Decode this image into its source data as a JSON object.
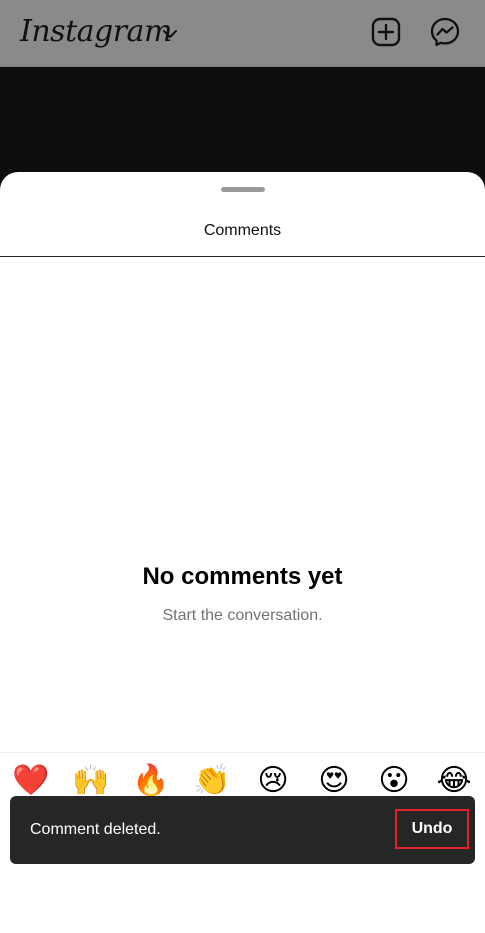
{
  "header": {
    "title": "Instagram",
    "icons": {
      "chevron": "chevron-down-icon",
      "add": "add-square-icon",
      "messenger": "messenger-icon"
    }
  },
  "sheet": {
    "title": "Comments",
    "empty_state": {
      "title": "No comments yet",
      "subtitle": "Start the conversation."
    }
  },
  "emoji_bar": {
    "emojis": [
      {
        "name": "red-heart",
        "char": "❤️"
      },
      {
        "name": "raising-hands",
        "char": "🙌"
      },
      {
        "name": "fire",
        "char": "🔥"
      },
      {
        "name": "clapping-hands",
        "char": "👏"
      },
      {
        "name": "crying-face",
        "char": "😢"
      },
      {
        "name": "heart-eyes",
        "char": "😍"
      },
      {
        "name": "astonished-face",
        "char": "😮"
      },
      {
        "name": "tears-of-joy",
        "char": "😂"
      }
    ]
  },
  "snackbar": {
    "message": "Comment deleted.",
    "action_label": "Undo",
    "highlight_color": "#e0202a"
  },
  "colors": {
    "header_bg": "#8a8a8a",
    "snackbar_bg": "#262626",
    "subtitle": "#737373"
  }
}
